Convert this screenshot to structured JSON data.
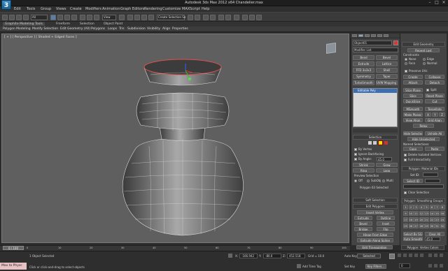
{
  "titlebar": {
    "title": "Autodesk 3ds Max 2012 x64    Chandelier.max",
    "logo": "3"
  },
  "menus": [
    "Edit",
    "Tools",
    "Group",
    "Views",
    "Create",
    "Modifiers",
    "Animation",
    "Graph Editors",
    "Rendering",
    "Customize",
    "MAXScript",
    "Help"
  ],
  "toolbar": {
    "selection_filter": "All",
    "view_dropdown": "View",
    "named_selection": "Create Selection Se"
  },
  "ribbon": {
    "tabs": [
      "Graphite Modeling Tools",
      "Freeform",
      "Selection",
      "Object Paint"
    ],
    "items": [
      "Polygon Modeling",
      "Modify Selection",
      "Edit",
      "Geometry (All)",
      "Polygons",
      "Loops",
      "Tris",
      "Subdivision",
      "Visibility",
      "Align",
      "Properties"
    ]
  },
  "viewport": {
    "label": "[ + ] [ Perspective ] [ Shaded + Edged Faces ]"
  },
  "command_panel": {
    "object_name": "Object01",
    "modifier_list": "Modifier List",
    "modifier_buttons": [
      "Bend",
      "Bevel",
      "Extrude",
      "Lattice",
      "FFD 3x3x3",
      "Shell",
      "Symmetry",
      "Taper",
      "TurboSmooth",
      "UVW Mapping Cl"
    ],
    "stack_item": "Editable Poly",
    "selection": {
      "header": "Selection",
      "by_vertex": "By Vertex",
      "ignore_backfacing": "Ignore Backfacing",
      "by_angle": "By Angle:",
      "by_angle_value": "45.0",
      "shrink": "Shrink",
      "grow": "Grow",
      "ring": "Ring",
      "loop": "Loop",
      "preview_label": "Preview Selection",
      "preview_off": "Off",
      "preview_subobj": "SubObj",
      "preview_multi": "Multi",
      "status": "Polygon 63 Selected"
    },
    "soft_selection": "Soft Selection",
    "edit_polygons": "Edit Polygons",
    "insert_vertex": "Insert Vertex",
    "extrude": "Extrude",
    "outline": "Outline",
    "bevel": "Bevel",
    "inset": "Inset",
    "bridge": "Bridge",
    "flip": "Flip",
    "hinge": "Hinge From Edge",
    "extrude_spline": "Extrude Along Spline",
    "edit_triangulation": "Edit Triangulation",
    "retriangulate": "Retriangulate",
    "turn": "Turn"
  },
  "right_panel": {
    "edit_geometry": "Edit Geometry",
    "repeat_last": "Repeat Last",
    "constraints": "Constraints",
    "c_none": "None",
    "c_edge": "Edge",
    "c_face": "Face",
    "c_normal": "Normal",
    "preserve_uvs": "Preserve UVs",
    "create": "Create",
    "collapse": "Collapse",
    "attach": "Attach",
    "detach": "Detach",
    "slice_plane": "Slice Plane",
    "split": "Split",
    "slice": "Slice",
    "reset_plane": "Reset Plane",
    "quickslice": "QuickSlice",
    "cut": "Cut",
    "msmooth": "MSmooth",
    "tessellate": "Tessellate",
    "make_planar": "Make Planar",
    "x": "X",
    "y": "Y",
    "z": "Z",
    "view_align": "View Align",
    "grid_align": "Grid Align",
    "relax": "Relax",
    "hide_selected": "Hide Selected",
    "unhide_all": "Unhide All",
    "hide_unselected": "Hide Unselected",
    "named_selections": "Named Selections:",
    "copy": "Copy",
    "paste": "Paste",
    "delete_isolated": "Delete Isolated Vertices",
    "full_interactivity": "Full Interactivity",
    "polygon_material_ids": "Polygon: Material IDs",
    "set_id": "Set ID:",
    "select_id": "Select ID",
    "clear_selection": "Clear Selection",
    "smoothing_groups": "Polygon: Smoothing Groups",
    "sg_numbers": [
      "1",
      "2",
      "3",
      "4",
      "5",
      "6",
      "7",
      "8",
      "9",
      "10",
      "11",
      "12",
      "13",
      "14",
      "15",
      "16",
      "17",
      "18",
      "19",
      "20",
      "21",
      "22",
      "23",
      "24",
      "25",
      "26",
      "27",
      "28",
      "29",
      "30",
      "31",
      "32"
    ],
    "select_by_sg": "Select By SG",
    "clear_all": "Clear All",
    "auto_smooth": "Auto Smooth",
    "auto_smooth_value": "45.0",
    "vertex_colors": "Polygon: Vertex Colors"
  },
  "timeline": {
    "slider": "0 / 100",
    "ticks": [
      "0",
      "10",
      "20",
      "30",
      "40",
      "50",
      "60",
      "70",
      "80",
      "90",
      "100"
    ]
  },
  "status": {
    "maxscript": "Max to Physc",
    "selected": "1 Object Selected",
    "prompt": "Click or click-and-drag to select objects",
    "x_label": "X:",
    "x_value": "-166.942",
    "y_label": "Y:",
    "y_value": "-80.0",
    "z_label": "Z:",
    "z_value": "452.518",
    "grid": "Grid = 10.0",
    "autokey": "Auto Key",
    "setkey": "Set Key",
    "key_mode": "Selected",
    "key_filters": "Key Filters...",
    "add_time_tag": "Add Time Tag",
    "frame": "0"
  }
}
